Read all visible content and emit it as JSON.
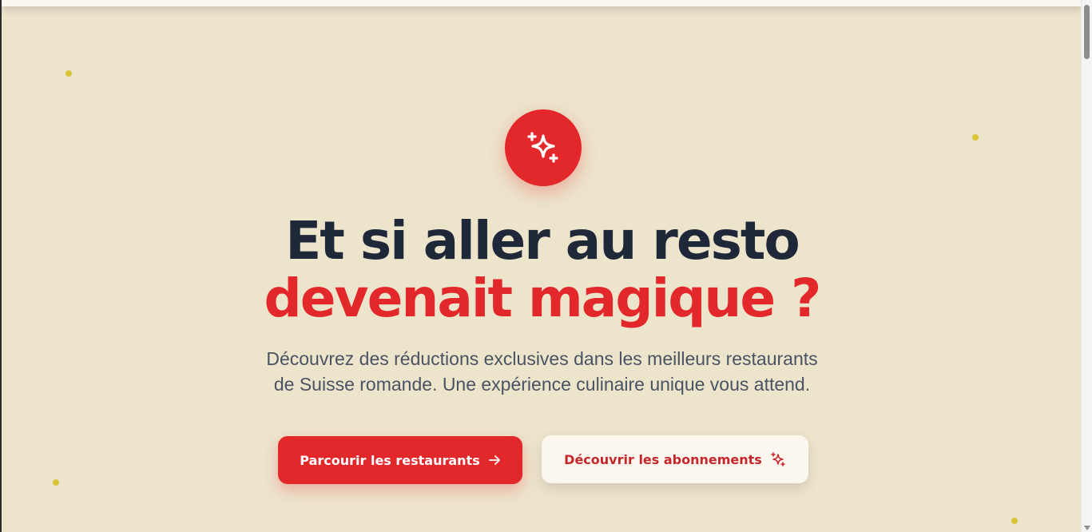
{
  "hero": {
    "headline_line1": "Et si aller au resto",
    "headline_line2": "devenait magique ?",
    "subtitle_line1": "Découvrez des réductions exclusives dans les meilleurs restaurants",
    "subtitle_line2": "de Suisse romande. Une expérience culinaire unique vous attend.",
    "icon": "sparkles-icon"
  },
  "actions": {
    "primary_label": "Parcourir les restaurants",
    "primary_icon": "arrow-right-icon",
    "secondary_label": "Découvrir les abonnements",
    "secondary_icon": "sparkles-icon"
  },
  "colors": {
    "background": "#ede4cc",
    "accent": "#e3282b",
    "heading": "#1e2839",
    "body_text": "#4a5363",
    "decor_dot": "#d9c437"
  }
}
